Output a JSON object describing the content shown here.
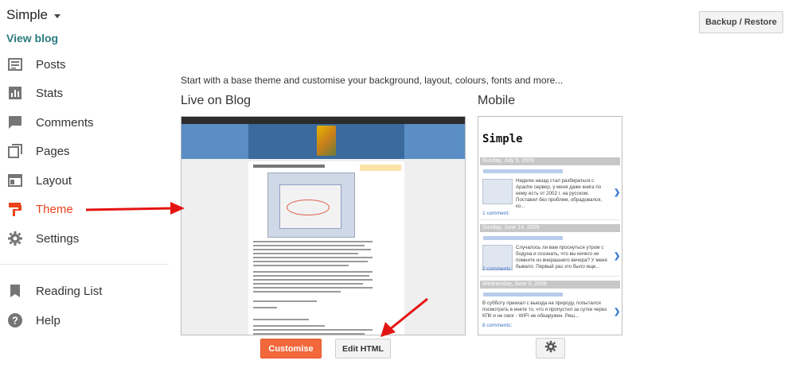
{
  "sidebar": {
    "blog_title": "Simple",
    "view_blog": "View blog",
    "items": [
      {
        "label": "Posts",
        "icon": "posts-icon"
      },
      {
        "label": "Stats",
        "icon": "stats-icon"
      },
      {
        "label": "Comments",
        "icon": "comments-icon"
      },
      {
        "label": "Pages",
        "icon": "pages-icon"
      },
      {
        "label": "Layout",
        "icon": "layout-icon"
      },
      {
        "label": "Theme",
        "icon": "theme-icon"
      },
      {
        "label": "Settings",
        "icon": "settings-icon"
      }
    ],
    "secondary_items": [
      {
        "label": "Reading List",
        "icon": "reading-list-icon"
      },
      {
        "label": "Help",
        "icon": "help-icon"
      }
    ],
    "active_item": "Theme",
    "accent_color": "#e8431b"
  },
  "header": {
    "backup_label": "Backup / Restore"
  },
  "main": {
    "intro": "Start with a base theme and customise your background, layout, colours, fonts and more...",
    "live_title": "Live on Blog",
    "mobile_title": "Mobile",
    "customise_label": "Customise",
    "edit_html_label": "Edit HTML",
    "gear_icon": "gear-icon"
  },
  "mobile_preview": {
    "title": "Simple",
    "posts": [
      {
        "date": "Sunday, July 5, 2009",
        "text": "Неделю назад стал разбираться с Apache сервер, у меня даже книга по нему есть от 2002 г. на русском. Поставил без проблем, обрадовался, ко...",
        "comments": "1 comment:"
      },
      {
        "date": "Sunday, June 14, 2009",
        "text": "Случалось ли вам проснуться утром с бодуна и осознать, что вы ничего не помните из вчерашнего вечера? У меня бывало. Первый раз это было еще...",
        "comments": "2 comments:"
      },
      {
        "date": "Wednesday, June 3, 2009",
        "text": "В субботу приехал с выезда на природу, попытался посмотреть в инете то, что я пропустил за сутки через КПК и не смог - WIFI не обнаружен. Реш...",
        "comments": "8 comments:"
      }
    ]
  }
}
